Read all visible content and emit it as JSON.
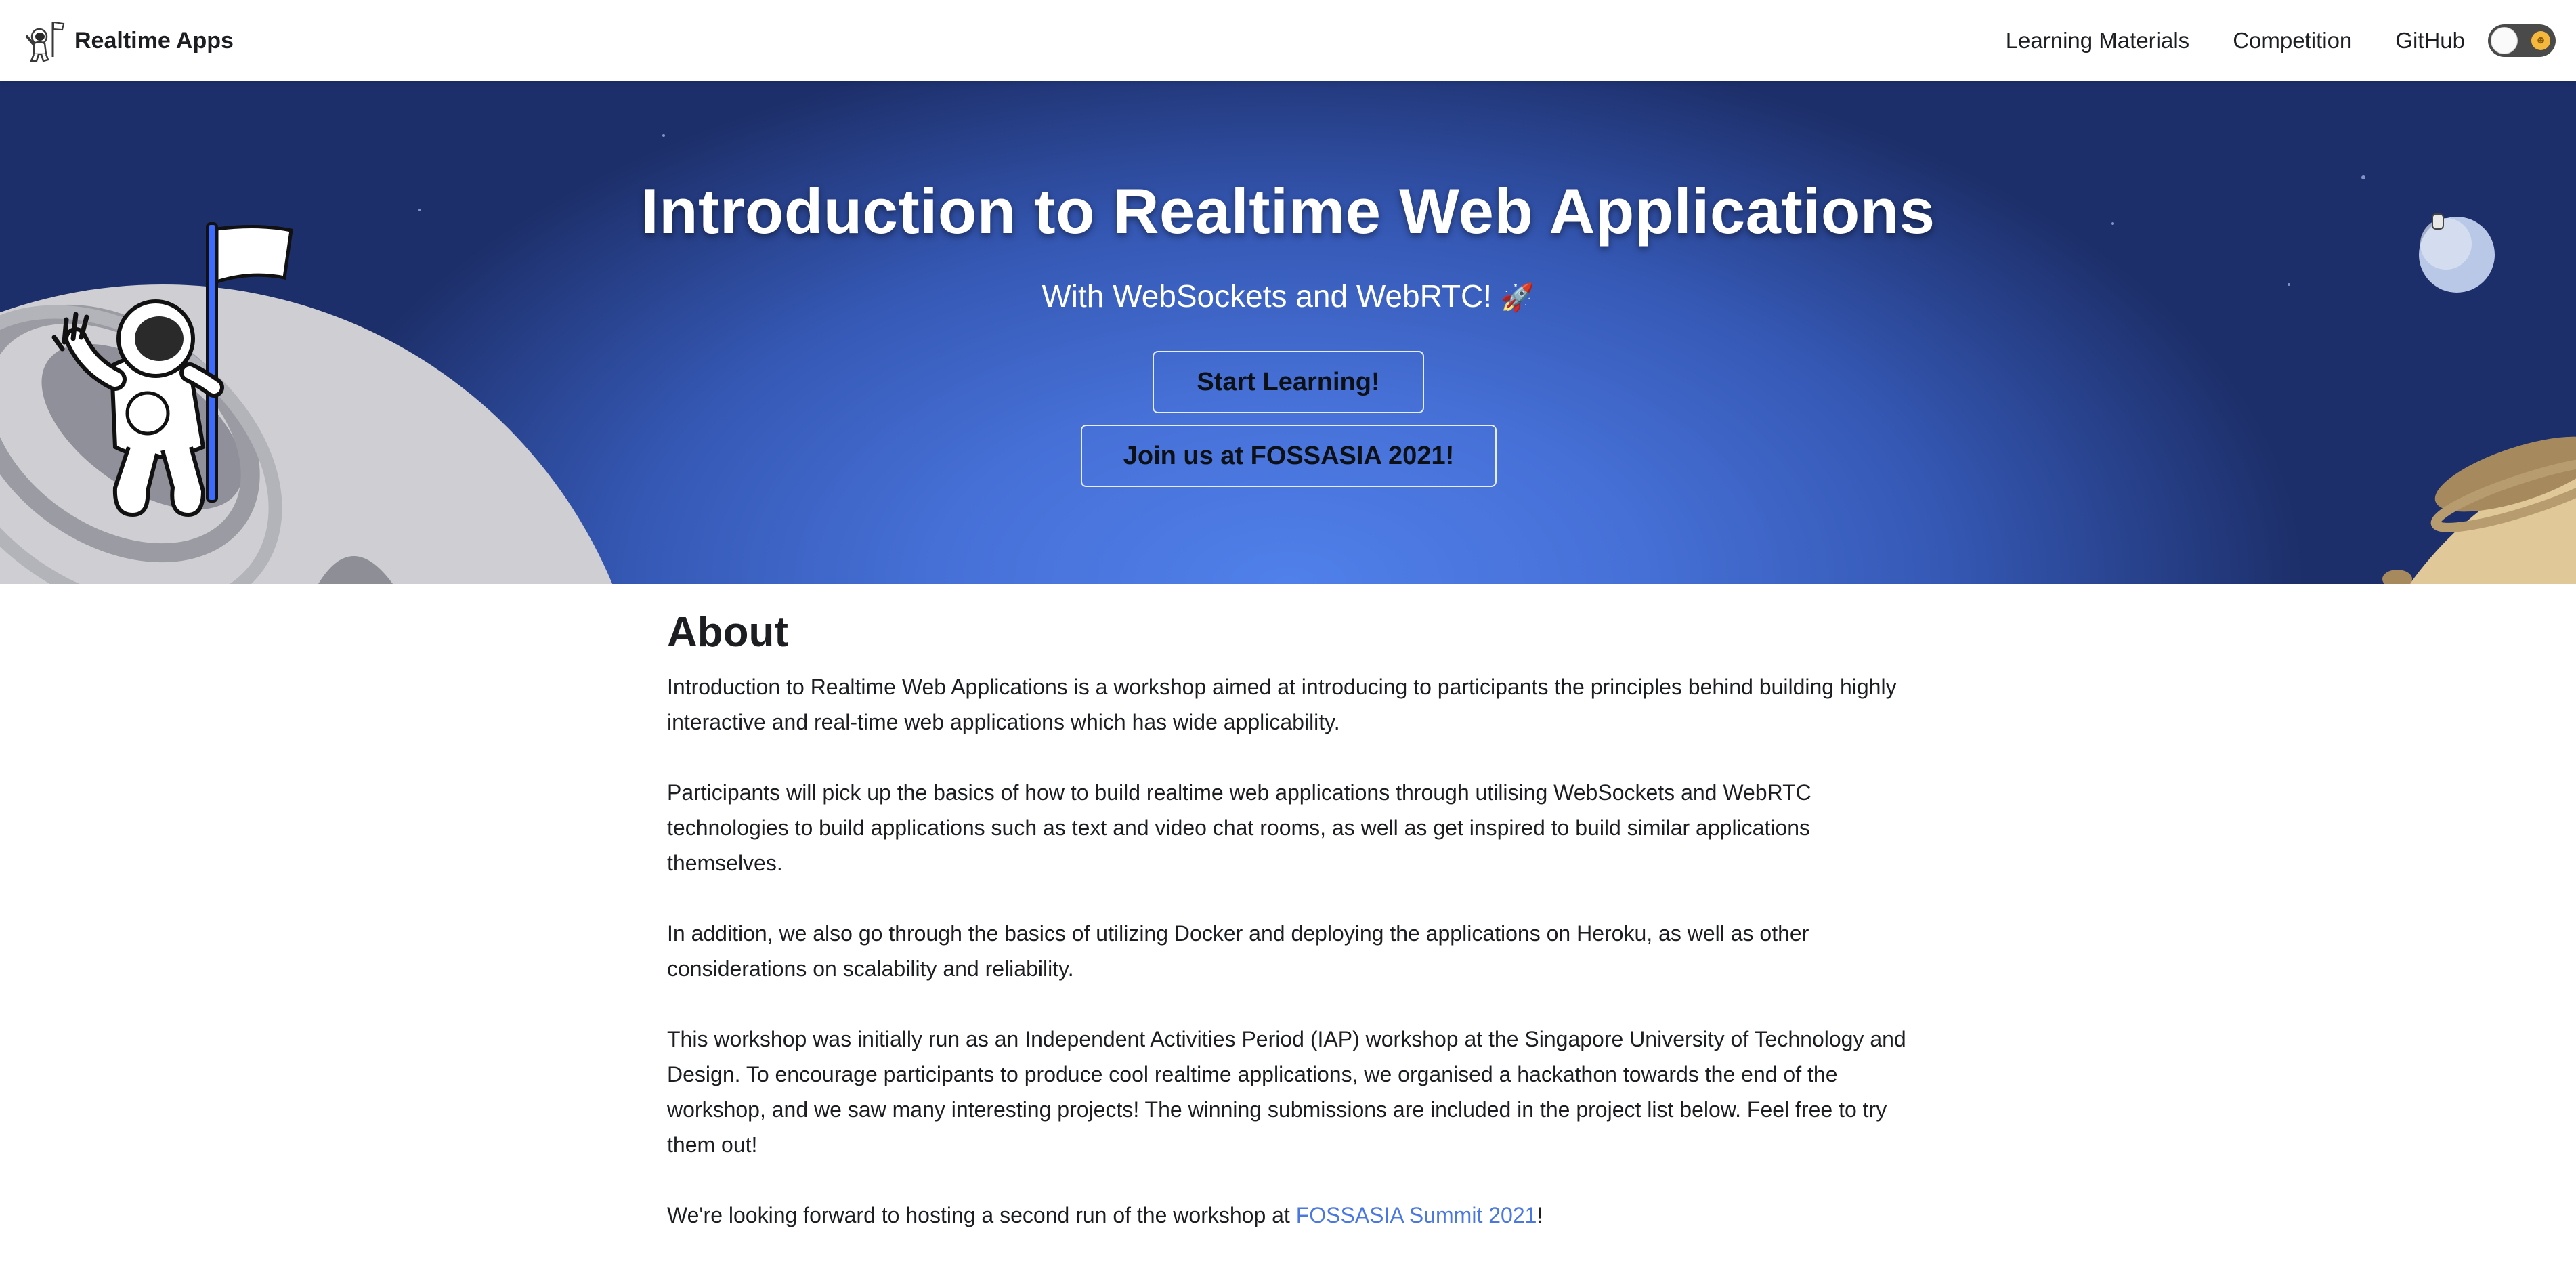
{
  "navbar": {
    "brand_title": "Realtime Apps",
    "links": [
      "Learning Materials",
      "Competition",
      "GitHub"
    ],
    "theme_toggle": {
      "state": "light",
      "icon": "sun-icon"
    }
  },
  "hero": {
    "title": "Introduction to Realtime Web Applications",
    "subtitle": "With WebSockets and WebRTC!",
    "subtitle_emoji": "🚀",
    "buttons": {
      "start": "Start Learning!",
      "join": "Join us at FOSSASIA 2021!"
    },
    "illustrations": [
      "astronaut-with-flag",
      "grey-moon",
      "small-planet",
      "tan-planet"
    ]
  },
  "about": {
    "title": "About",
    "paragraphs": [
      "Introduction to Realtime Web Applications is a workshop aimed at introducing to participants the principles behind building highly interactive and real-time web applications which has wide applicability.",
      "Participants will pick up the basics of how to build realtime web applications through utilising WebSockets and WebRTC technologies to build applications such as text and video chat rooms, as well as get inspired to build similar applications themselves.",
      "In addition, we also go through the basics of utilizing Docker and deploying the applications on Heroku, as well as other considerations on scalability and reliability.",
      "This workshop was initially run as an Independent Activities Period (IAP) workshop at the Singapore University of Technology and Design. To encourage participants to produce cool realtime applications, we organised a hackathon towards the end of the workshop, and we saw many interesting projects! The winning submissions are included in the project list below. Feel free to try them out!"
    ],
    "last_paragraph": {
      "before": "We're looking forward to hosting a second run of the workshop at ",
      "link": "FOSSASIA Summit 2021",
      "after": "!"
    }
  },
  "colors": {
    "hero_center": "#5080ea",
    "hero_edge": "#1d2f6a",
    "link": "#4a78e0",
    "text": "#1c1e21"
  }
}
